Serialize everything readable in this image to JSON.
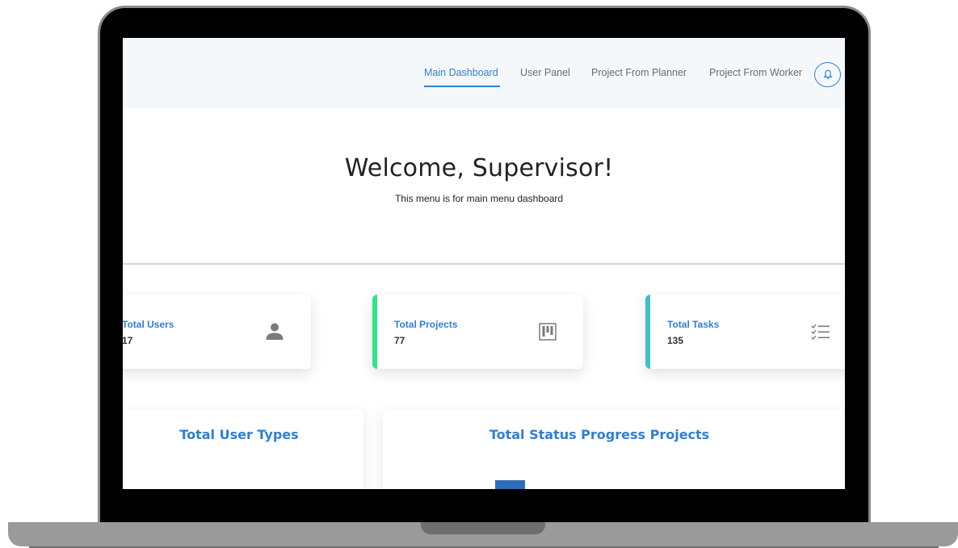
{
  "nav": {
    "items": [
      {
        "label": "Main Dashboard",
        "active": true
      },
      {
        "label": "User Panel",
        "active": false
      },
      {
        "label": "Project From Planner",
        "active": false
      },
      {
        "label": "Project From Worker",
        "active": false
      }
    ],
    "notification_icon": "bell-icon"
  },
  "hero": {
    "title": "Welcome, Supervisor!",
    "subtitle": "This menu is for main menu dashboard"
  },
  "stats": [
    {
      "label": "Total Users",
      "value": "17",
      "icon": "user-icon"
    },
    {
      "label": "Total Projects",
      "value": "77",
      "icon": "kanban-icon",
      "accent": "#2ee58a"
    },
    {
      "label": "Total Tasks",
      "value": "135",
      "icon": "checklist-icon",
      "accent": "#3bc1c9"
    }
  ],
  "panels": [
    {
      "title": "Total User Types"
    },
    {
      "title": "Total Status Progress Projects"
    }
  ],
  "colors": {
    "accent": "#2f7fd6",
    "bar": "#2f6eb5"
  }
}
